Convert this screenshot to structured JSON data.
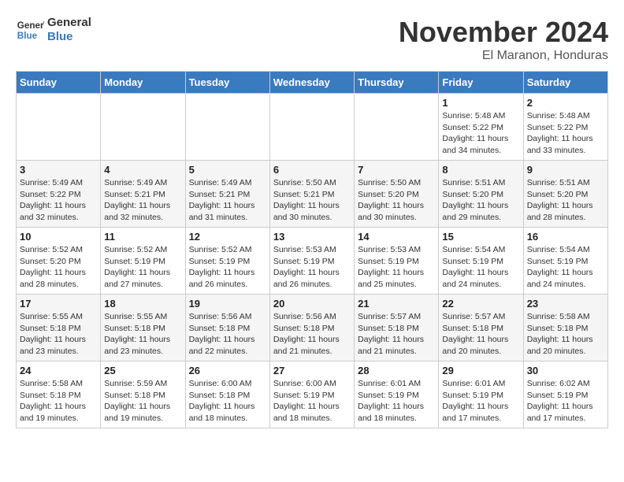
{
  "header": {
    "logo_line1": "General",
    "logo_line2": "Blue",
    "month": "November 2024",
    "location": "El Maranon, Honduras"
  },
  "weekdays": [
    "Sunday",
    "Monday",
    "Tuesday",
    "Wednesday",
    "Thursday",
    "Friday",
    "Saturday"
  ],
  "weeks": [
    [
      {
        "day": "",
        "info": ""
      },
      {
        "day": "",
        "info": ""
      },
      {
        "day": "",
        "info": ""
      },
      {
        "day": "",
        "info": ""
      },
      {
        "day": "",
        "info": ""
      },
      {
        "day": "1",
        "info": "Sunrise: 5:48 AM\nSunset: 5:22 PM\nDaylight: 11 hours and 34 minutes."
      },
      {
        "day": "2",
        "info": "Sunrise: 5:48 AM\nSunset: 5:22 PM\nDaylight: 11 hours and 33 minutes."
      }
    ],
    [
      {
        "day": "3",
        "info": "Sunrise: 5:49 AM\nSunset: 5:22 PM\nDaylight: 11 hours and 32 minutes."
      },
      {
        "day": "4",
        "info": "Sunrise: 5:49 AM\nSunset: 5:21 PM\nDaylight: 11 hours and 32 minutes."
      },
      {
        "day": "5",
        "info": "Sunrise: 5:49 AM\nSunset: 5:21 PM\nDaylight: 11 hours and 31 minutes."
      },
      {
        "day": "6",
        "info": "Sunrise: 5:50 AM\nSunset: 5:21 PM\nDaylight: 11 hours and 30 minutes."
      },
      {
        "day": "7",
        "info": "Sunrise: 5:50 AM\nSunset: 5:20 PM\nDaylight: 11 hours and 30 minutes."
      },
      {
        "day": "8",
        "info": "Sunrise: 5:51 AM\nSunset: 5:20 PM\nDaylight: 11 hours and 29 minutes."
      },
      {
        "day": "9",
        "info": "Sunrise: 5:51 AM\nSunset: 5:20 PM\nDaylight: 11 hours and 28 minutes."
      }
    ],
    [
      {
        "day": "10",
        "info": "Sunrise: 5:52 AM\nSunset: 5:20 PM\nDaylight: 11 hours and 28 minutes."
      },
      {
        "day": "11",
        "info": "Sunrise: 5:52 AM\nSunset: 5:19 PM\nDaylight: 11 hours and 27 minutes."
      },
      {
        "day": "12",
        "info": "Sunrise: 5:52 AM\nSunset: 5:19 PM\nDaylight: 11 hours and 26 minutes."
      },
      {
        "day": "13",
        "info": "Sunrise: 5:53 AM\nSunset: 5:19 PM\nDaylight: 11 hours and 26 minutes."
      },
      {
        "day": "14",
        "info": "Sunrise: 5:53 AM\nSunset: 5:19 PM\nDaylight: 11 hours and 25 minutes."
      },
      {
        "day": "15",
        "info": "Sunrise: 5:54 AM\nSunset: 5:19 PM\nDaylight: 11 hours and 24 minutes."
      },
      {
        "day": "16",
        "info": "Sunrise: 5:54 AM\nSunset: 5:19 PM\nDaylight: 11 hours and 24 minutes."
      }
    ],
    [
      {
        "day": "17",
        "info": "Sunrise: 5:55 AM\nSunset: 5:18 PM\nDaylight: 11 hours and 23 minutes."
      },
      {
        "day": "18",
        "info": "Sunrise: 5:55 AM\nSunset: 5:18 PM\nDaylight: 11 hours and 23 minutes."
      },
      {
        "day": "19",
        "info": "Sunrise: 5:56 AM\nSunset: 5:18 PM\nDaylight: 11 hours and 22 minutes."
      },
      {
        "day": "20",
        "info": "Sunrise: 5:56 AM\nSunset: 5:18 PM\nDaylight: 11 hours and 21 minutes."
      },
      {
        "day": "21",
        "info": "Sunrise: 5:57 AM\nSunset: 5:18 PM\nDaylight: 11 hours and 21 minutes."
      },
      {
        "day": "22",
        "info": "Sunrise: 5:57 AM\nSunset: 5:18 PM\nDaylight: 11 hours and 20 minutes."
      },
      {
        "day": "23",
        "info": "Sunrise: 5:58 AM\nSunset: 5:18 PM\nDaylight: 11 hours and 20 minutes."
      }
    ],
    [
      {
        "day": "24",
        "info": "Sunrise: 5:58 AM\nSunset: 5:18 PM\nDaylight: 11 hours and 19 minutes."
      },
      {
        "day": "25",
        "info": "Sunrise: 5:59 AM\nSunset: 5:18 PM\nDaylight: 11 hours and 19 minutes."
      },
      {
        "day": "26",
        "info": "Sunrise: 6:00 AM\nSunset: 5:18 PM\nDaylight: 11 hours and 18 minutes."
      },
      {
        "day": "27",
        "info": "Sunrise: 6:00 AM\nSunset: 5:19 PM\nDaylight: 11 hours and 18 minutes."
      },
      {
        "day": "28",
        "info": "Sunrise: 6:01 AM\nSunset: 5:19 PM\nDaylight: 11 hours and 18 minutes."
      },
      {
        "day": "29",
        "info": "Sunrise: 6:01 AM\nSunset: 5:19 PM\nDaylight: 11 hours and 17 minutes."
      },
      {
        "day": "30",
        "info": "Sunrise: 6:02 AM\nSunset: 5:19 PM\nDaylight: 11 hours and 17 minutes."
      }
    ]
  ]
}
